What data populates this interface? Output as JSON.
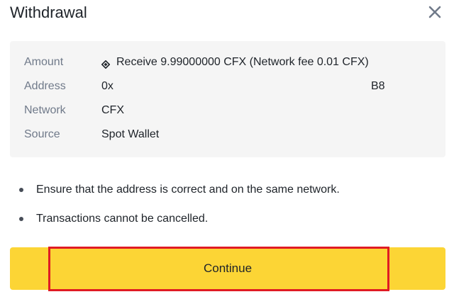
{
  "dialog": {
    "title": "Withdrawal",
    "close_icon": "close-icon"
  },
  "summary": {
    "amount": {
      "label": "Amount",
      "icon": "receive-diamond-icon",
      "value": "Receive 9.99000000 CFX (Network fee 0.01 CFX)"
    },
    "address": {
      "label": "Address",
      "value_start": "0x",
      "value_end": "B8"
    },
    "network": {
      "label": "Network",
      "value": "CFX"
    },
    "source": {
      "label": "Source",
      "value": "Spot Wallet"
    }
  },
  "notes": [
    "Ensure that the address is correct and on the same network.",
    "Transactions cannot be cancelled."
  ],
  "actions": {
    "continue_label": "Continue"
  },
  "colors": {
    "accent": "#fcd535",
    "highlight": "#e01b24",
    "label": "#707a8a",
    "text": "#1e2329",
    "panel": "#f5f5f5"
  }
}
